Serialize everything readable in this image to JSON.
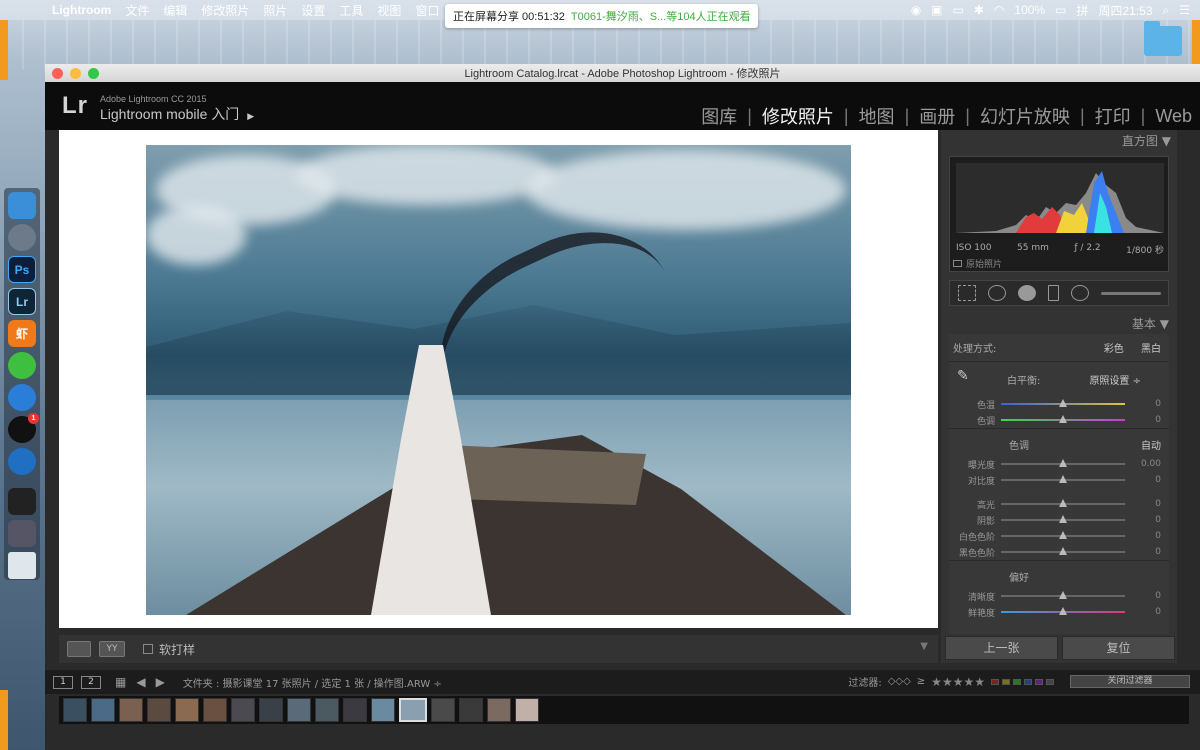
{
  "menubar": {
    "app_name": "Lightroom",
    "items": [
      "文件",
      "编辑",
      "修改照片",
      "照片",
      "设置",
      "工具",
      "视图",
      "窗口"
    ],
    "battery": "100%",
    "input_method": "拼",
    "clock": "周四21:53"
  },
  "share_banner": {
    "status": "正在屏幕分享 00:51:32",
    "watching": "T0061-舞汐雨、S...等104人正在观看"
  },
  "window": {
    "title": "Lightroom Catalog.lrcat - Adobe Photoshop Lightroom - 修改照片"
  },
  "header": {
    "logo": "Lr",
    "brand": "Adobe Lightroom CC 2015",
    "mobile": "Lightroom mobile 入门",
    "modules": [
      "图库",
      "修改照片",
      "地图",
      "画册",
      "幻灯片放映",
      "打印",
      "Web"
    ],
    "active_module": "修改照片"
  },
  "dock": {
    "ps": "Ps",
    "lr": "Lr",
    "xia": "虾",
    "qq_badge": "1"
  },
  "toolbar": {
    "yy_label": "YY",
    "soft_proof": "软打样"
  },
  "right_panel": {
    "histogram_title": "直方图",
    "iso": "ISO 100",
    "focal": "55 mm",
    "aperture": "ƒ / 2.2",
    "shutter": "1/800 秒",
    "original_photo": "原始照片",
    "basic_title": "基本",
    "process": {
      "label": "处理方式:",
      "color": "彩色",
      "bw": "黑白"
    },
    "white_balance": {
      "label": "白平衡:",
      "value": "原照设置 ÷"
    },
    "wb_sliders": [
      {
        "name": "色温",
        "value": "0",
        "pos": 0.5
      },
      {
        "name": "色调",
        "value": "0",
        "pos": 0.5
      }
    ],
    "tone": {
      "title": "色调",
      "auto": "自动"
    },
    "tone_sliders": [
      {
        "name": "曝光度",
        "value": "0.00",
        "pos": 0.5
      },
      {
        "name": "对比度",
        "value": "0",
        "pos": 0.5
      }
    ],
    "light_sliders": [
      {
        "name": "高光",
        "value": "0",
        "pos": 0.5
      },
      {
        "name": "阴影",
        "value": "0",
        "pos": 0.5
      },
      {
        "name": "白色色阶",
        "value": "0",
        "pos": 0.5
      },
      {
        "name": "黑色色阶",
        "value": "0",
        "pos": 0.5
      }
    ],
    "presence": {
      "title": "偏好"
    },
    "presence_sliders": [
      {
        "name": "清晰度",
        "value": "0",
        "pos": 0.5
      },
      {
        "name": "鲜艳度",
        "value": "0",
        "pos": 0.5
      }
    ],
    "prev_button": "上一张",
    "reset_button": "复位"
  },
  "filmstrip": {
    "page1": "1",
    "page2": "2",
    "info": "文件夹 : 摄影课堂   17 张照片 / 选定 1 张 / 操作图.ARW ÷",
    "filter_label": "过滤器:",
    "rating_op": "≥",
    "filter_select": "关闭过滤器"
  },
  "colors": {
    "accent_orange": "#f29a1e",
    "panel_bg": "#333333",
    "header_bg": "#0c0c0c"
  }
}
